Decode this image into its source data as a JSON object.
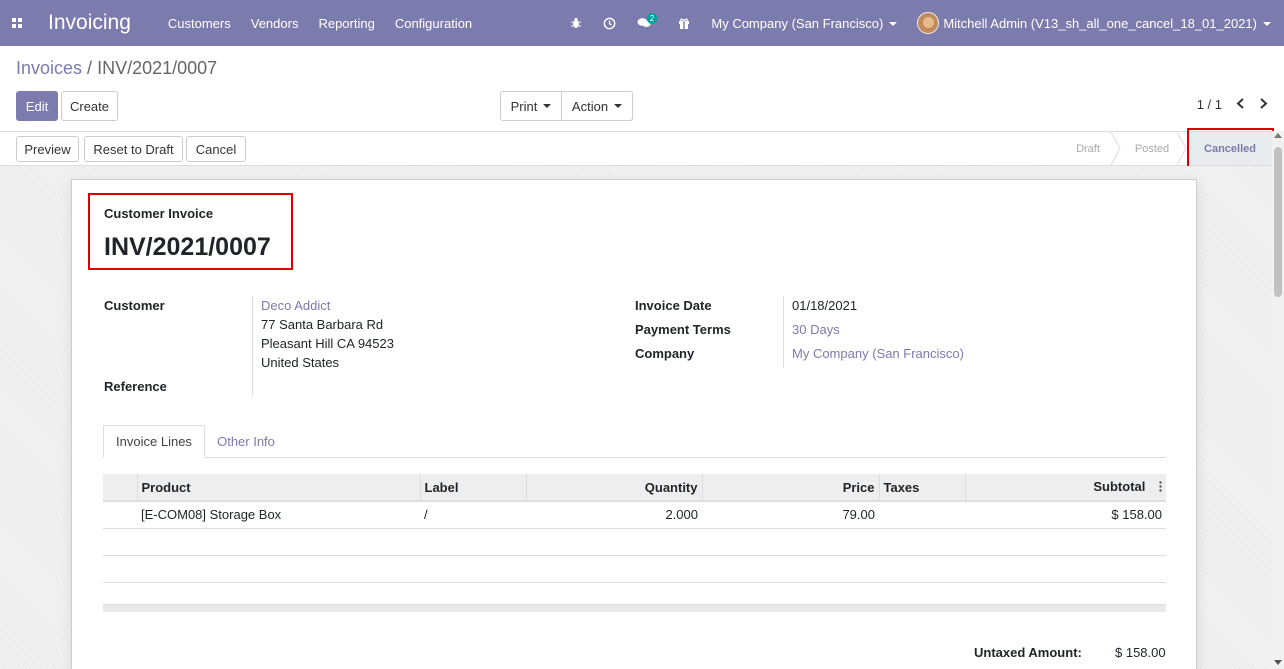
{
  "navbar": {
    "app_title": "Invoicing",
    "menu": [
      "Customers",
      "Vendors",
      "Reporting",
      "Configuration"
    ],
    "messages_count": "2",
    "company": "My Company (San Francisco)",
    "user": "Mitchell Admin (V13_sh_all_one_cancel_18_01_2021)",
    "color": "#7c7bad"
  },
  "breadcrumb": {
    "parent": "Invoices",
    "separator": " / ",
    "current": "INV/2021/0007"
  },
  "control": {
    "edit_label": "Edit",
    "create_label": "Create",
    "print_label": "Print",
    "action_label": "Action",
    "pager_value": "1 / 1"
  },
  "statusbar": {
    "buttons": [
      "Preview",
      "Reset to Draft",
      "Cancel"
    ],
    "stages": [
      "Draft",
      "Posted",
      "Cancelled"
    ],
    "active_stage": "Cancelled"
  },
  "invoice": {
    "type_label": "Customer Invoice",
    "number": "INV/2021/0007",
    "customer_label": "Customer",
    "customer_name": "Deco Addict",
    "address_1": "77 Santa Barbara Rd",
    "address_2": "Pleasant Hill CA 94523",
    "address_3": "United States",
    "reference_label": "Reference",
    "invoice_date_label": "Invoice Date",
    "invoice_date": "01/18/2021",
    "payment_terms_label": "Payment Terms",
    "payment_terms": "30 Days",
    "company_label": "Company",
    "company": "My Company (San Francisco)"
  },
  "tabs": [
    "Invoice Lines",
    "Other Info"
  ],
  "lines": {
    "headers": [
      "Product",
      "Label",
      "Quantity",
      "Price",
      "Taxes",
      "Subtotal"
    ],
    "rows": [
      {
        "product": "[E-COM08] Storage Box",
        "label": "/",
        "quantity": "2.000",
        "price": "79.00",
        "taxes": "",
        "subtotal": "$ 158.00"
      }
    ]
  },
  "totals": {
    "untaxed_label": "Untaxed Amount:",
    "untaxed_value": "$ 158.00"
  }
}
